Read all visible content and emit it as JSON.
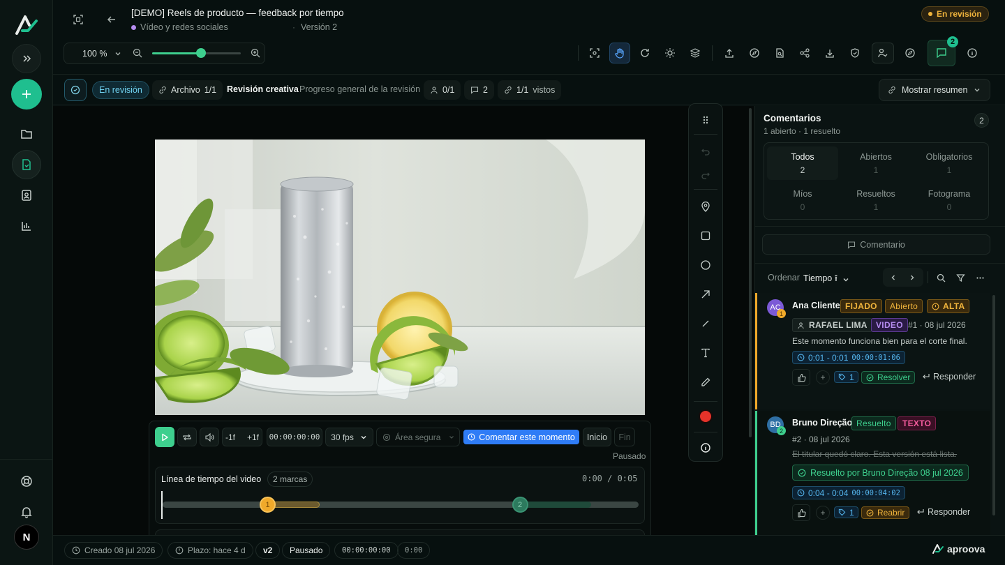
{
  "app": {
    "brand": "aproova",
    "user_initial": "N"
  },
  "header": {
    "title": "[DEMO] Reels de producto — feedback por tiempo",
    "project": "Vídeo y redes sociales",
    "separator": "·",
    "version": "Versión 2",
    "status_badge": "En revisión",
    "zoom": "100 %",
    "zoom_level": 0.55,
    "comment_count": "2"
  },
  "subheader": {
    "status": "En revisión",
    "file_label": "Archivo",
    "file_count": "1/1",
    "review_title": "Revisión creativa",
    "review_progress": "Progreso general de la revisión",
    "reviewers": "0/1",
    "comments": "2",
    "viewed_count": "1/1",
    "viewed_label": "vistos",
    "summary_button": "Mostrar resumen"
  },
  "player": {
    "step_back": "-1f",
    "step_forward": "+1f",
    "timecode": "00:00:00:00",
    "fps": "30 fps",
    "safe_area": "Área segura",
    "comment_moment": "Comentar este momento",
    "start": "Inicio",
    "end": "Fin",
    "state": "Pausado",
    "timeline_title": "Línea de tiempo del video",
    "markers_count": "2 marcas",
    "time_display": "0:00 / 0:05",
    "marker1": "1",
    "marker2": "2",
    "marker1_position": 0.22,
    "marker2_position": 0.75
  },
  "comments_panel": {
    "title": "Comentarios",
    "subtitle": "1 abierto · 1 resuelto",
    "count": "2",
    "filters": [
      {
        "label": "Todos",
        "count": "2"
      },
      {
        "label": "Abiertos",
        "count": "1"
      },
      {
        "label": "Obligatorios",
        "count": "1"
      },
      {
        "label": "Míos",
        "count": "0"
      },
      {
        "label": "Resueltos",
        "count": "1"
      },
      {
        "label": "Fotograma",
        "count": "0"
      }
    ],
    "comment_button": "Comentario",
    "sort_label": "Ordenar",
    "sort_value": "Tiempo ⭱",
    "items": [
      {
        "initials": "AC",
        "number": "1",
        "author": "Ana Cliente",
        "badge_pinned": "FIJADO",
        "badge_status": "Abierto",
        "badge_priority": "ALTA",
        "assignee": "RAFAEL LIMA",
        "type": "VIDEO",
        "meta": "#1 · 08 jul 2026",
        "text": "Este momento funciona bien para el corte final.",
        "time_range": "0:01 - 0:01",
        "timecode": "00:00:01:06",
        "tag_count": "1",
        "action": "Resolver",
        "reply": "Responder"
      },
      {
        "initials": "BD",
        "number": "2",
        "author": "Bruno Direção",
        "badge_status": "Resuelto",
        "type": "TEXTO",
        "meta": "#2 · 08 jul 2026",
        "text": "El titular quedó claro. Esta versión está lista.",
        "resolved_by": "Resuelto por Bruno Direção 08 jul 2026",
        "time_range": "0:04 - 0:04",
        "timecode": "00:00:04:02",
        "tag_count": "1",
        "action": "Reabrir",
        "reply": "Responder"
      }
    ]
  },
  "footer": {
    "created": "Creado 08 jul 2026",
    "deadline": "Plazo: hace 4 d",
    "version": "v2",
    "state": "Pausado",
    "timecode": "00:00:00:00",
    "time": "0:00"
  },
  "colors": {
    "accent": "#1fbf8f",
    "blue": "#2f7cf6",
    "warning": "#e0a33a",
    "resolved": "#3ecf8e",
    "record": "#e5332a"
  }
}
